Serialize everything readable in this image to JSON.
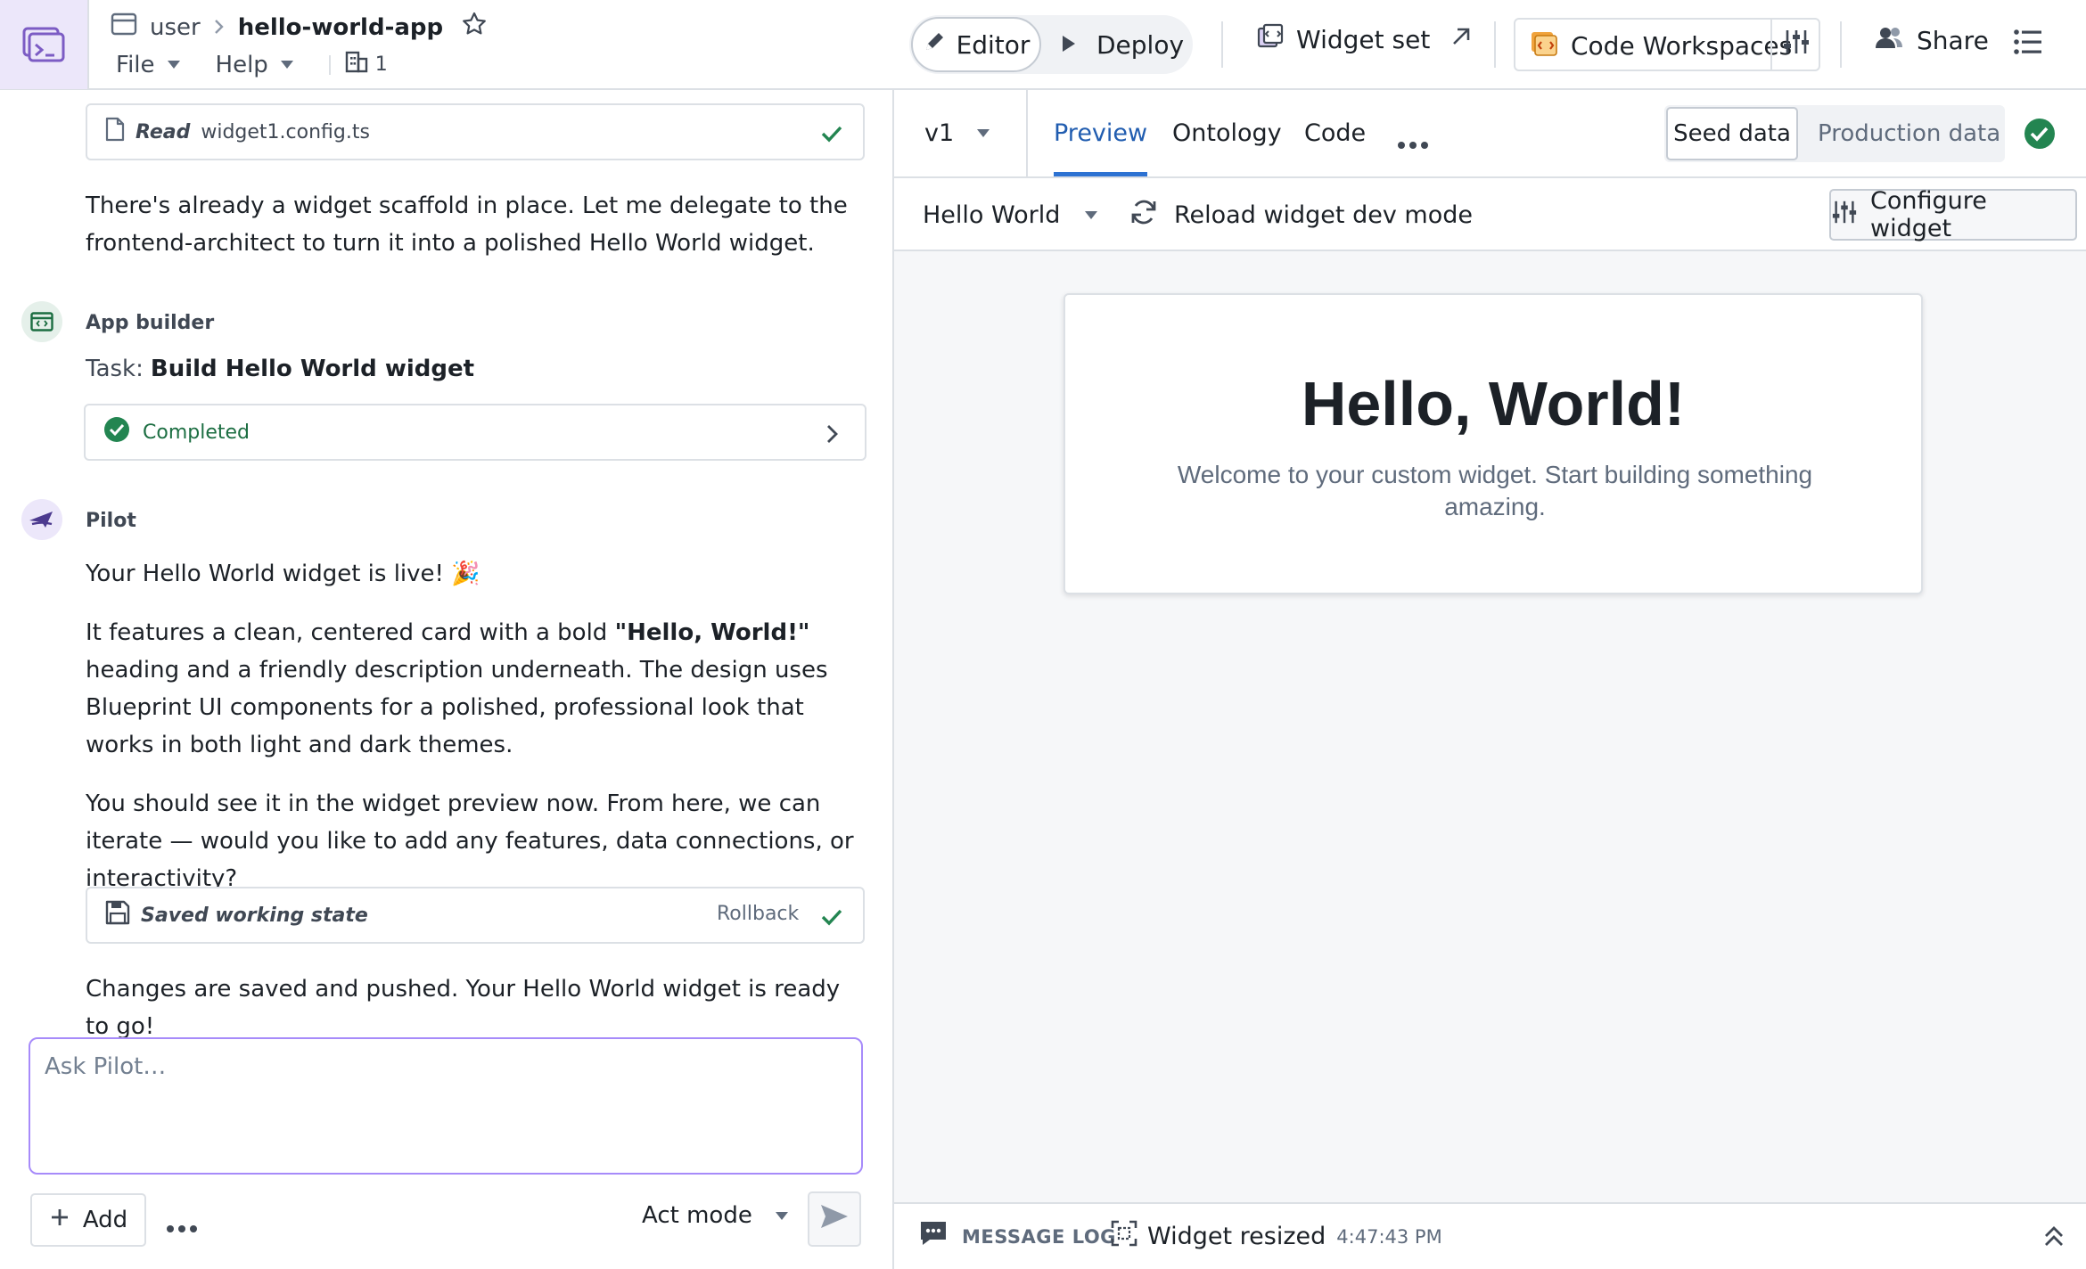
{
  "header": {
    "breadcrumb": {
      "parent": "user",
      "current": "hello-world-app"
    },
    "menus": {
      "file": "File",
      "help": "Help"
    },
    "member_count": "1",
    "editor_label": "Editor",
    "deploy_label": "Deploy",
    "widget_set_label": "Widget set",
    "code_workspaces_label": "Code Workspaces",
    "share_label": "Share"
  },
  "chat": {
    "read_tool": {
      "verb": "Read",
      "file": "widget1.config.ts"
    },
    "message_intro": "There's already a widget scaffold in place. Let me delegate to the frontend-architect to turn it into a polished Hello World widget.",
    "app_builder": {
      "name": "App builder",
      "task_prefix": "Task:",
      "task_name": "Build Hello World widget",
      "status": "Completed"
    },
    "pilot": {
      "name": "Pilot",
      "line1": "Your Hello World widget is live! 🎉",
      "para2_before": "It features a clean, centered card with a bold ",
      "para2_bold": "\"Hello, World!\"",
      "para2_after": " heading and a friendly description underneath. The design uses Blueprint UI components for a polished, professional look that works in both light and dark themes.",
      "para3": "You should see it in the widget preview now. From here, we can iterate — would you like to add any features, data connections, or interactivity?",
      "saved_state": {
        "label": "Saved working state",
        "rollback": "Rollback"
      },
      "final": "Changes are saved and pushed. Your Hello World widget is ready to go!"
    },
    "input": {
      "placeholder": "Ask Pilot…",
      "value": ""
    },
    "add_label": "Add",
    "mode_label": "Act mode"
  },
  "preview": {
    "version": "v1",
    "tabs": {
      "preview": "Preview",
      "ontology": "Ontology",
      "code": "Code"
    },
    "data_modes": {
      "seed": "Seed data",
      "production": "Production data"
    },
    "widget_select": "Hello World",
    "reload_label": "Reload widget dev mode",
    "configure_label": "Configure widget",
    "widget": {
      "heading": "Hello, World!",
      "description": "Welcome to your custom widget. Start building something amazing."
    },
    "status_bar": {
      "message_log": "MESSAGE LOG",
      "event": "Widget resized",
      "time": "4:47:43 PM"
    }
  },
  "colors": {
    "accent_blue": "#2d72d2",
    "success_green": "#238551",
    "brand_purple": "#7c5cc4",
    "input_border": "#a78bfa"
  },
  "icons": [
    "app-logo-icon",
    "folder-icon",
    "star-icon",
    "building-icon",
    "pencil-icon",
    "play-icon",
    "widget-icon",
    "external-link-icon",
    "code-workspace-icon",
    "sliders-icon",
    "people-icon",
    "list-icon",
    "document-icon",
    "check-icon",
    "app-builder-icon",
    "check-circle-icon",
    "chevron-right-icon",
    "pilot-icon",
    "save-icon",
    "plus-icon",
    "more-icon",
    "send-icon",
    "refresh-icon",
    "chat-icon",
    "resize-icon",
    "double-chevron-up-icon"
  ]
}
